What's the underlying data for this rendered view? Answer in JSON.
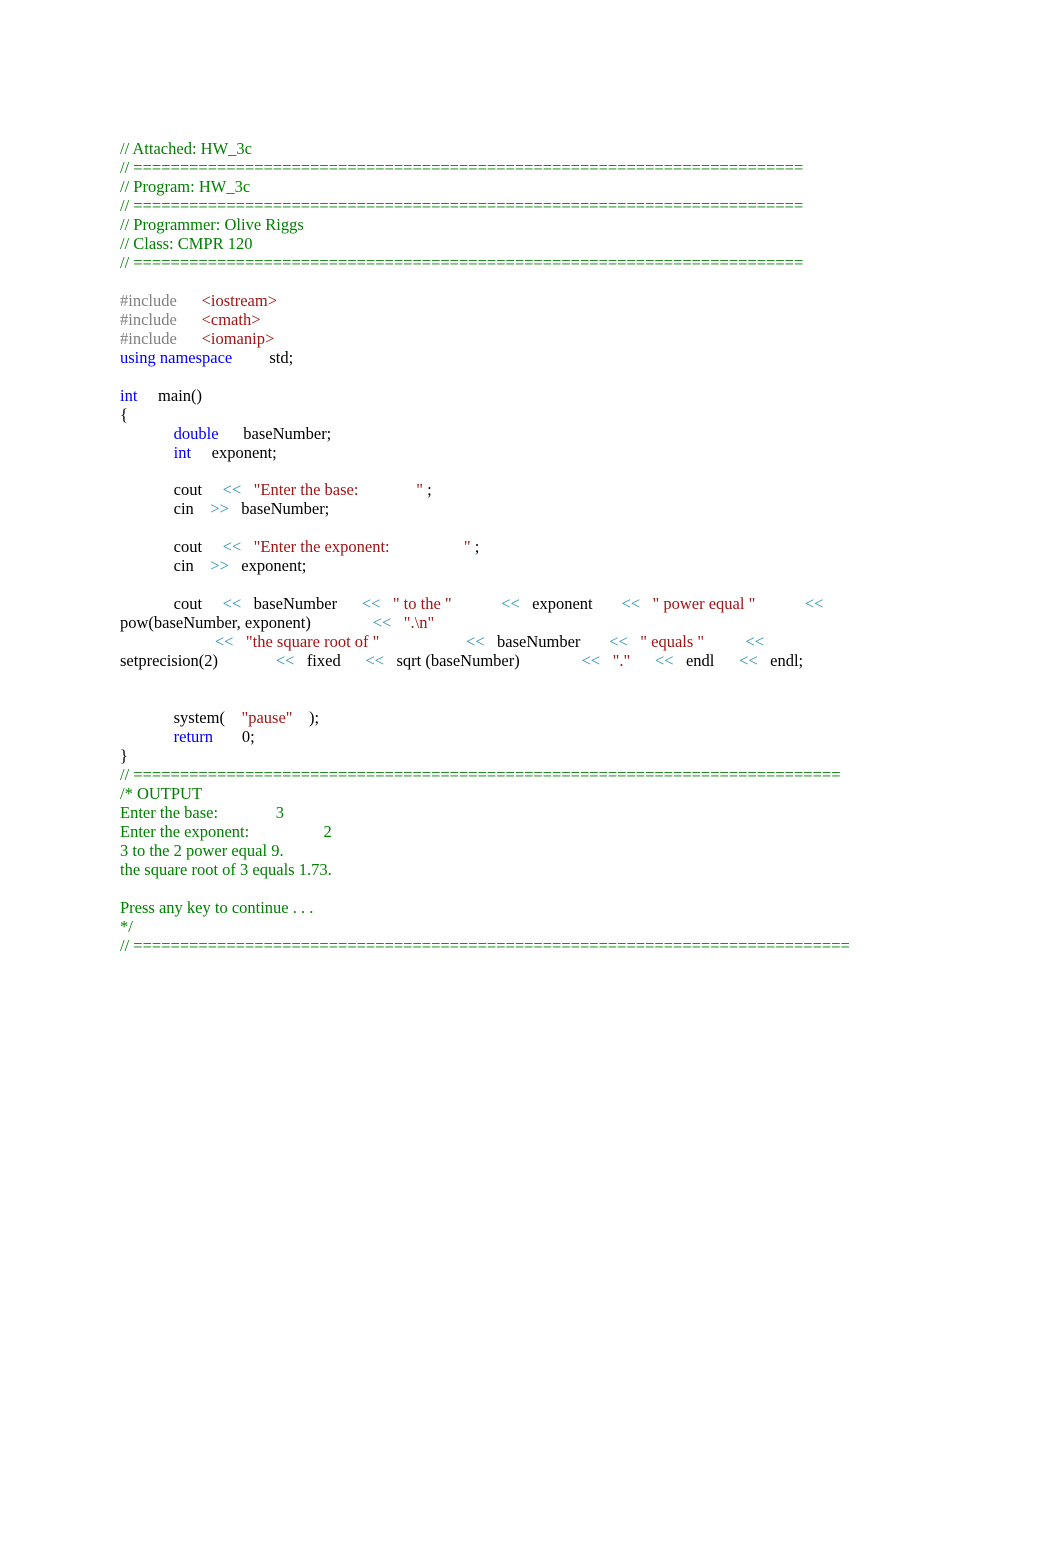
{
  "lines": [
    [
      [
        "green",
        "// Attached: HW_3c"
      ]
    ],
    [
      [
        "green",
        "// ========================================================================"
      ]
    ],
    [
      [
        "green",
        "// Program: HW_3c"
      ]
    ],
    [
      [
        "green",
        "// ========================================================================"
      ]
    ],
    [
      [
        "green",
        "// Programmer: Olive Riggs"
      ]
    ],
    [
      [
        "green",
        "// Class: CMPR 120"
      ]
    ],
    [
      [
        "green",
        "// ========================================================================"
      ]
    ],
    [
      [
        "black",
        ""
      ]
    ],
    [
      [
        "gray",
        "#include      "
      ],
      [
        "maroon",
        "<iostream>"
      ]
    ],
    [
      [
        "gray",
        "#include      "
      ],
      [
        "maroon",
        "<cmath>"
      ]
    ],
    [
      [
        "gray",
        "#include      "
      ],
      [
        "maroon",
        "<iomanip>"
      ]
    ],
    [
      [
        "blue",
        "using namespace"
      ],
      [
        "black",
        "         std;"
      ]
    ],
    [
      [
        "black",
        ""
      ]
    ],
    [
      [
        "blue",
        "int"
      ],
      [
        "black",
        "     main()"
      ]
    ],
    [
      [
        "black",
        "{"
      ]
    ],
    [
      [
        "black",
        "             "
      ],
      [
        "blue",
        "double"
      ],
      [
        "black",
        "      baseNumber;"
      ]
    ],
    [
      [
        "black",
        "             "
      ],
      [
        "blue",
        "int"
      ],
      [
        "black",
        "     exponent;"
      ]
    ],
    [
      [
        "black",
        ""
      ]
    ],
    [
      [
        "black",
        "             cout     "
      ],
      [
        "teal",
        "<<   "
      ],
      [
        "maroon",
        "\"Enter the base:              \""
      ],
      [
        "black",
        " ;"
      ]
    ],
    [
      [
        "black",
        "             cin    "
      ],
      [
        "teal",
        ">> "
      ],
      [
        "black",
        "  baseNumber;"
      ]
    ],
    [
      [
        "black",
        ""
      ]
    ],
    [
      [
        "black",
        "             cout     "
      ],
      [
        "teal",
        "<<   "
      ],
      [
        "maroon",
        "\"Enter the exponent:                  \""
      ],
      [
        "black",
        " ;"
      ]
    ],
    [
      [
        "black",
        "             cin    "
      ],
      [
        "teal",
        ">> "
      ],
      [
        "black",
        "  exponent;"
      ]
    ],
    [
      [
        "black",
        ""
      ]
    ],
    [
      [
        "black",
        "             cout     "
      ],
      [
        "teal",
        "<< "
      ],
      [
        "black",
        "  baseNumber      "
      ],
      [
        "teal",
        "<<  "
      ],
      [
        "maroon",
        " \" to the \""
      ],
      [
        "black",
        "            "
      ],
      [
        "teal",
        "<< "
      ],
      [
        "black",
        "  exponent       "
      ],
      [
        "teal",
        "<<  "
      ],
      [
        "maroon",
        " \" power equal \""
      ],
      [
        "black",
        "            "
      ],
      [
        "teal",
        "<<  "
      ]
    ],
    [
      [
        "black",
        "pow(baseNumber, exponent)               "
      ],
      [
        "teal",
        "<<  "
      ],
      [
        "maroon",
        " \".\\n\""
      ]
    ],
    [
      [
        "black",
        "                       "
      ],
      [
        "teal",
        "<<   "
      ],
      [
        "maroon",
        "\"the square root of \""
      ],
      [
        "black",
        "                     "
      ],
      [
        "teal",
        "<< "
      ],
      [
        "black",
        "  baseNumber       "
      ],
      [
        "teal",
        "<<  "
      ],
      [
        "maroon",
        " \" equals \""
      ],
      [
        "black",
        "          "
      ],
      [
        "teal",
        "<<  "
      ]
    ],
    [
      [
        "black",
        "setprecision(2)              "
      ],
      [
        "teal",
        "<<  "
      ],
      [
        "black",
        " fixed      "
      ],
      [
        "teal",
        "<< "
      ],
      [
        "black",
        "  sqrt (baseNumber)               "
      ],
      [
        "teal",
        "<<   "
      ],
      [
        "maroon",
        "\".\""
      ],
      [
        "black",
        "      "
      ],
      [
        "teal",
        "<< "
      ],
      [
        "black",
        "  endl      "
      ],
      [
        "teal",
        "<< "
      ],
      [
        "black",
        "  endl;"
      ]
    ],
    [
      [
        "black",
        ""
      ]
    ],
    [
      [
        "black",
        ""
      ]
    ],
    [
      [
        "black",
        "             system(    "
      ],
      [
        "maroon",
        "\"pause\""
      ],
      [
        "black",
        "    );"
      ]
    ],
    [
      [
        "black",
        "             "
      ],
      [
        "blue",
        "return"
      ],
      [
        "black",
        "       0;"
      ]
    ],
    [
      [
        "black",
        "}"
      ]
    ],
    [
      [
        "green",
        "// ============================================================================"
      ]
    ],
    [
      [
        "green",
        "/* OUTPUT"
      ]
    ],
    [
      [
        "green",
        "Enter the base:              3"
      ]
    ],
    [
      [
        "green",
        "Enter the exponent:                  2"
      ]
    ],
    [
      [
        "green",
        "3 to the 2 power equal 9."
      ]
    ],
    [
      [
        "green",
        "the square root of 3 equals 1.73."
      ]
    ],
    [
      [
        "green",
        ""
      ]
    ],
    [
      [
        "green",
        "Press any key to continue . . ."
      ]
    ],
    [
      [
        "green",
        "*/"
      ]
    ],
    [
      [
        "green",
        "// ============================================================================="
      ]
    ]
  ]
}
